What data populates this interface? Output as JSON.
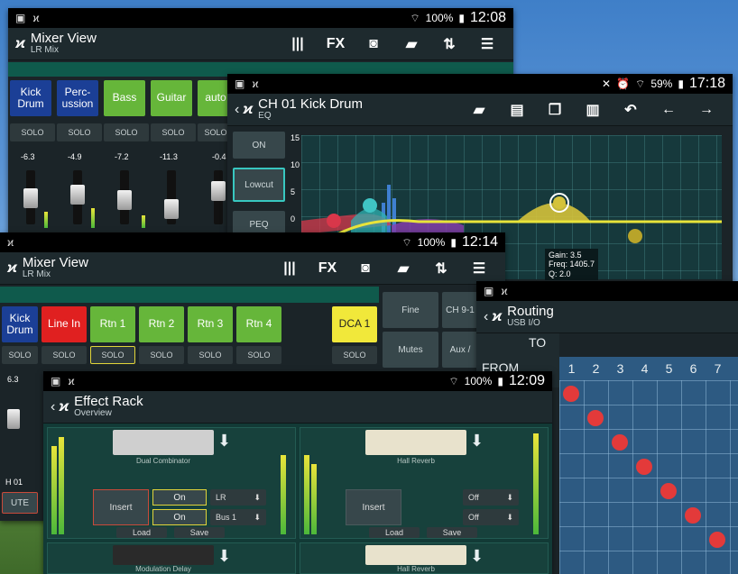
{
  "mixer_top": {
    "battery": "100%",
    "clock": "12:08",
    "title": "Mixer View",
    "subtitle": "LR Mix",
    "fx_label": "FX",
    "channels": [
      "Kick Drum",
      "Perc-ussion",
      "Bass",
      "Guitar",
      "auto"
    ],
    "solo_label": "SOLO",
    "levels": [
      "-6.3",
      "-4.9",
      "-7.2",
      "-11.3",
      "-0.4"
    ]
  },
  "eq": {
    "battery": "59%",
    "clock": "17:18",
    "title": "CH 01 Kick Drum",
    "subtitle": "EQ",
    "buttons": [
      "ON",
      "Lowcut",
      "PEQ"
    ],
    "y_ticks": [
      "15",
      "10",
      "5",
      "0"
    ],
    "readout": {
      "gain": "Gain: 3.5",
      "freq": "Freq: 1405.7",
      "q": "Q: 2.0"
    }
  },
  "mixer_mid": {
    "battery": "100%",
    "clock": "12:14",
    "title": "Mixer View",
    "subtitle": "LR Mix",
    "fx_label": "FX",
    "channels": [
      "Kick Drum",
      "Line In",
      "Rtn 1",
      "Rtn 2",
      "Rtn 3",
      "Rtn 4"
    ],
    "dca": "DCA 1",
    "side": [
      "Fine",
      "CH 9-1",
      "Mutes",
      "Aux /"
    ],
    "solo_label": "SOLO",
    "ch_label": "H 01",
    "mute_label": "UTE",
    "level": "6.3"
  },
  "routing": {
    "title": "Routing",
    "subtitle": "USB I/O",
    "to_label": "TO",
    "from_label": "FROM",
    "columns": [
      "1",
      "2",
      "3",
      "4",
      "5",
      "6",
      "7"
    ]
  },
  "effect_rack": {
    "battery": "100%",
    "clock": "12:09",
    "title": "Effect Rack",
    "subtitle": "Overview",
    "slot1": {
      "name": "Dual Combinator",
      "insert": "Insert",
      "on1": "On",
      "on2": "On",
      "route1": "LR",
      "route2": "Bus 1",
      "load": "Load",
      "save": "Save"
    },
    "slot2": {
      "name": "Hall Reverb",
      "insert": "Insert",
      "off1": "Off",
      "off2": "Off",
      "load": "Load",
      "save": "Save"
    },
    "slot3": {
      "name": "Modulation Delay"
    },
    "slot4": {
      "name": "Hall Reverb"
    }
  }
}
